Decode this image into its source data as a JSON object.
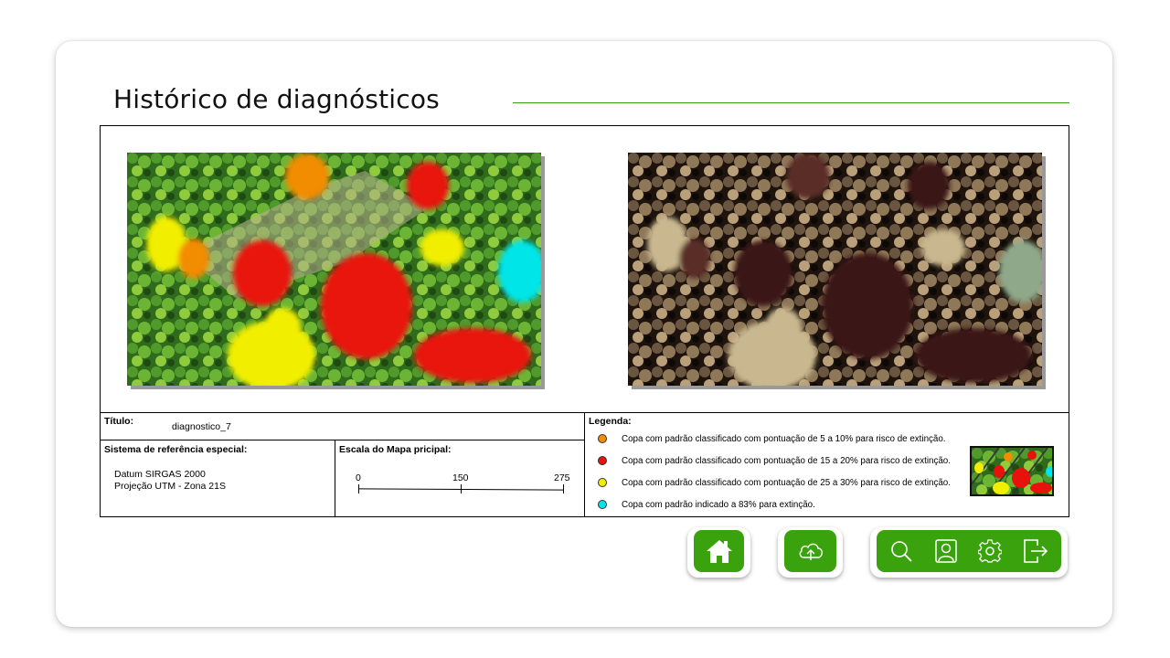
{
  "page": {
    "title": "Histórico de diagnósticos"
  },
  "colors": {
    "accent": "#3aa20c",
    "orange": "#f28c00",
    "red": "#e8120c",
    "yellow": "#f2ee00",
    "cyan": "#00e5e8"
  },
  "info": {
    "title_label": "Título:",
    "title_value": "diagnostico_7",
    "srs_label": "Sistema de referência especial:",
    "srs_datum": "Datum SIRGAS 2000",
    "srs_projection": "Projeção UTM - Zona 21S",
    "scale_label": "Escala do Mapa pricipal:",
    "scale_ticks": [
      "0",
      "150",
      "275"
    ],
    "legend_label": "Legenda:",
    "legend_items": [
      {
        "color": "#f28c00",
        "text": "Copa com padrão  classificado com pontuação de 5 a 10% para risco de extinção."
      },
      {
        "color": "#e8120c",
        "text": "Copa com padrão classificado com pontuação de 15 a 20% para risco de extinção."
      },
      {
        "color": "#f2ee00",
        "text": "Copa com padrão classificado com pontuação de 25 a 30% para risco de extinção."
      },
      {
        "color": "#00e5e8",
        "text": "Copa com padrão indicado a 83% para extinção."
      }
    ]
  },
  "toolbar": {
    "icons": [
      "home-icon",
      "cloud-upload-icon",
      "search-icon",
      "user-profile-icon",
      "gear-icon",
      "logout-icon"
    ]
  }
}
